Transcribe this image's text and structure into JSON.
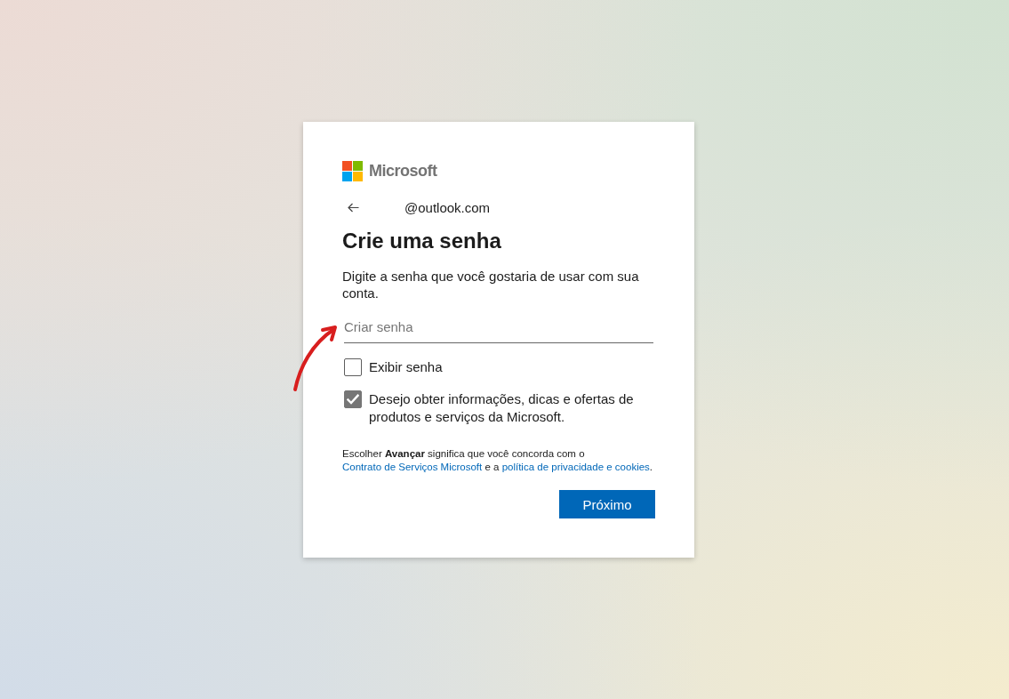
{
  "logo": {
    "text": "Microsoft"
  },
  "identity": {
    "email": "@outlook.com"
  },
  "title": "Crie uma senha",
  "description": "Digite a senha que você gostaria de usar com sua conta.",
  "password_field": {
    "placeholder": "Criar senha"
  },
  "checkboxes": [
    {
      "label": "Exibir senha",
      "checked": false
    },
    {
      "label": "Desejo obter informações, dicas e ofertas de produtos e serviços da Microsoft.",
      "checked": true
    }
  ],
  "legal": {
    "parts": [
      {
        "kind": "text",
        "text": "Escolher **Avançar** significa que você concorda com o "
      },
      {
        "kind": "link",
        "text": "Contrato de Serviços Microsoft"
      },
      {
        "kind": "text",
        "text": " e a "
      },
      {
        "kind": "link",
        "text": "política de privacidade e cookies"
      },
      {
        "kind": "text",
        "text": "."
      }
    ]
  },
  "buttons": [
    {
      "label": "Próximo"
    }
  ]
}
